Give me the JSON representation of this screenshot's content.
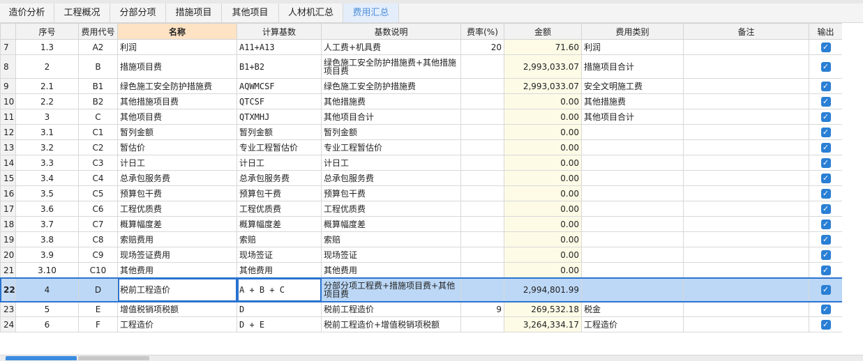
{
  "tabs": [
    {
      "label": "造价分析",
      "active": false
    },
    {
      "label": "工程概况",
      "active": false
    },
    {
      "label": "分部分项",
      "active": false
    },
    {
      "label": "措施项目",
      "active": false
    },
    {
      "label": "其他项目",
      "active": false
    },
    {
      "label": "人材机汇总",
      "active": false
    },
    {
      "label": "费用汇总",
      "active": true
    }
  ],
  "columns": {
    "seq": "序号",
    "code": "费用代号",
    "name": "名称",
    "base": "计算基数",
    "desc": "基数说明",
    "rate": "费率(%)",
    "amount": "金额",
    "category": "费用类别",
    "remark": "备注",
    "output": "输出"
  },
  "rows": [
    {
      "row": "7",
      "seq": "1.3",
      "code": "A2",
      "name": "利润",
      "base": "A11+A13",
      "desc": "人工费+机具费",
      "rate": "20",
      "amount": "71.60",
      "category": "利润",
      "remark": "",
      "output": "✓"
    },
    {
      "row": "8",
      "seq": "2",
      "code": "B",
      "name": "措施项目费",
      "base": "B1+B2",
      "desc": "绿色施工安全防护措施费+其他措施项目费",
      "rate": "",
      "amount": "2,993,033.07",
      "category": "措施项目合计",
      "remark": "",
      "output": "✓"
    },
    {
      "row": "9",
      "seq": "2.1",
      "code": "B1",
      "name": "绿色施工安全防护措施费",
      "base": "AQWMCSF",
      "desc": "绿色施工安全防护措施费",
      "rate": "",
      "amount": "2,993,033.07",
      "category": "安全文明施工费",
      "remark": "",
      "output": "✓"
    },
    {
      "row": "10",
      "seq": "2.2",
      "code": "B2",
      "name": "其他措施项目费",
      "base": "QTCSF",
      "desc": "其他措施费",
      "rate": "",
      "amount": "0.00",
      "category": "其他措施费",
      "remark": "",
      "output": "✓"
    },
    {
      "row": "11",
      "seq": "3",
      "code": "C",
      "name": "其他项目费",
      "base": "QTXMHJ",
      "desc": "其他项目合计",
      "rate": "",
      "amount": "0.00",
      "category": "其他项目合计",
      "remark": "",
      "output": "✓"
    },
    {
      "row": "12",
      "seq": "3.1",
      "code": "C1",
      "name": "暂列金额",
      "base": "暂列金额",
      "desc": "暂列金额",
      "rate": "",
      "amount": "0.00",
      "category": "",
      "remark": "",
      "output": "✓"
    },
    {
      "row": "13",
      "seq": "3.2",
      "code": "C2",
      "name": "暂估价",
      "base": "专业工程暂估价",
      "desc": "专业工程暂估价",
      "rate": "",
      "amount": "0.00",
      "category": "",
      "remark": "",
      "output": "✓"
    },
    {
      "row": "14",
      "seq": "3.3",
      "code": "C3",
      "name": "计日工",
      "base": "计日工",
      "desc": "计日工",
      "rate": "",
      "amount": "0.00",
      "category": "",
      "remark": "",
      "output": "✓"
    },
    {
      "row": "15",
      "seq": "3.4",
      "code": "C4",
      "name": "总承包服务费",
      "base": "总承包服务费",
      "desc": "总承包服务费",
      "rate": "",
      "amount": "0.00",
      "category": "",
      "remark": "",
      "output": "✓"
    },
    {
      "row": "16",
      "seq": "3.5",
      "code": "C5",
      "name": "预算包干费",
      "base": "预算包干费",
      "desc": "预算包干费",
      "rate": "",
      "amount": "0.00",
      "category": "",
      "remark": "",
      "output": "✓"
    },
    {
      "row": "17",
      "seq": "3.6",
      "code": "C6",
      "name": "工程优质费",
      "base": "工程优质费",
      "desc": "工程优质费",
      "rate": "",
      "amount": "0.00",
      "category": "",
      "remark": "",
      "output": "✓"
    },
    {
      "row": "18",
      "seq": "3.7",
      "code": "C7",
      "name": "概算幅度差",
      "base": "概算幅度差",
      "desc": "概算幅度差",
      "rate": "",
      "amount": "0.00",
      "category": "",
      "remark": "",
      "output": "✓"
    },
    {
      "row": "19",
      "seq": "3.8",
      "code": "C8",
      "name": "索赔费用",
      "base": "索赔",
      "desc": "索赔",
      "rate": "",
      "amount": "0.00",
      "category": "",
      "remark": "",
      "output": "✓"
    },
    {
      "row": "20",
      "seq": "3.9",
      "code": "C9",
      "name": "现场签证费用",
      "base": "现场签证",
      "desc": "现场签证",
      "rate": "",
      "amount": "0.00",
      "category": "",
      "remark": "",
      "output": "✓"
    },
    {
      "row": "21",
      "seq": "3.10",
      "code": "C10",
      "name": "其他费用",
      "base": "其他费用",
      "desc": "其他费用",
      "rate": "",
      "amount": "0.00",
      "category": "",
      "remark": "",
      "output": "✓"
    },
    {
      "row": "22",
      "seq": "4",
      "code": "D",
      "name": "税前工程造价",
      "base": "A + B + C",
      "desc": "分部分项工程费+措施项目费+其他项目费",
      "rate": "",
      "amount": "2,994,801.99",
      "category": "",
      "remark": "",
      "output": "✓"
    },
    {
      "row": "23",
      "seq": "5",
      "code": "E",
      "name": "增值税销项税额",
      "base": "D",
      "desc": "税前工程造价",
      "rate": "9",
      "amount": "269,532.18",
      "category": "税金",
      "remark": "",
      "output": "✓"
    },
    {
      "row": "24",
      "seq": "6",
      "code": "F",
      "name": "工程造价",
      "base": "D + E",
      "desc": "税前工程造价+增值税销项税额",
      "rate": "",
      "amount": "3,264,334.17",
      "category": "工程造价",
      "remark": "",
      "output": "✓"
    }
  ],
  "selected_row": "22",
  "colors": {
    "accent": "#2a73d0",
    "selected_row": "#bcd8f6",
    "amount_bg": "#fdfbe6",
    "name_header": "#fde3c4"
  }
}
